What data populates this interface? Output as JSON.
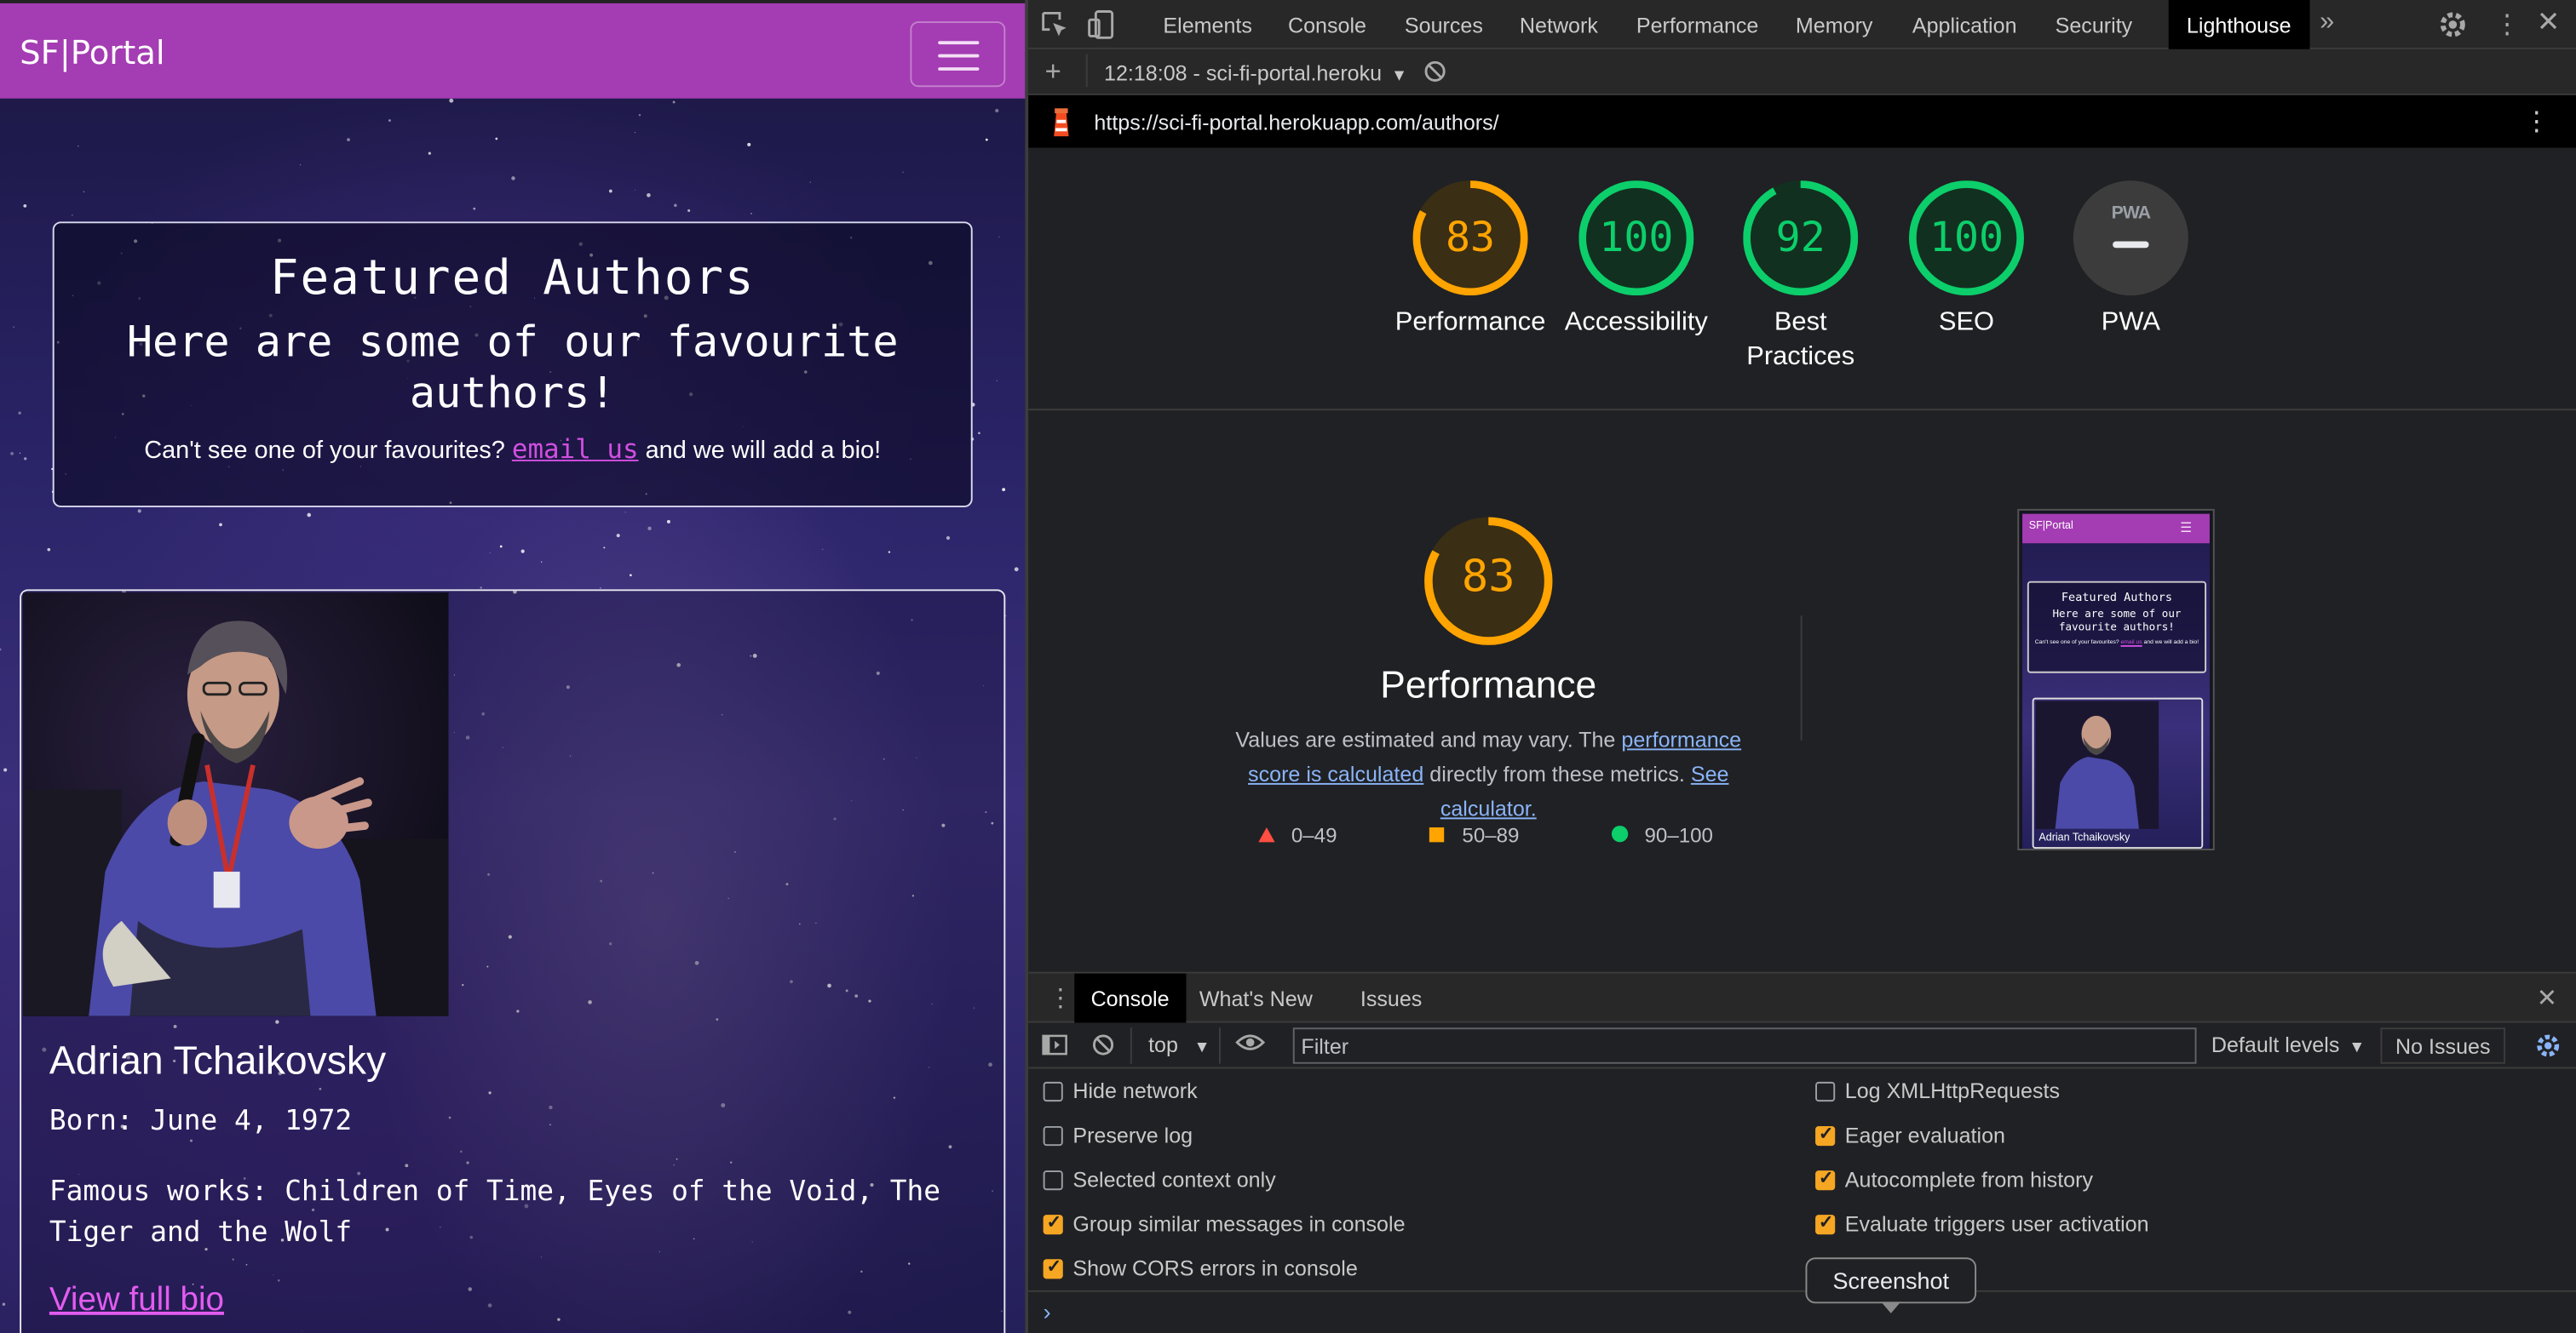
{
  "page": {
    "brand": "SF|Portal",
    "featured": {
      "title": "Featured Authors",
      "subtitle": "Here are some of our favourite authors!",
      "prompt_before": "Can't see one of your favourites?",
      "link": "email us",
      "prompt_after": "and we will add a bio!"
    },
    "author": {
      "name": "Adrian Tchaikovsky",
      "born": "Born: June 4, 1972",
      "works": "Famous works: Children of Time, Eyes of the Void, The Tiger and the Wolf",
      "bio_link": "View full bio"
    }
  },
  "devtools": {
    "tabs": [
      "Elements",
      "Console",
      "Sources",
      "Network",
      "Performance",
      "Memory",
      "Application",
      "Security",
      "Lighthouse"
    ],
    "active_tab": "Lighthouse",
    "report_selector": "12:18:08 - sci-fi-portal.heroku",
    "url": "https://sci-fi-portal.herokuapp.com/authors/",
    "scores": [
      {
        "label": "Performance",
        "value": "83",
        "level": 0.83,
        "color": "#ffa400"
      },
      {
        "label": "Accessibility",
        "value": "100",
        "level": 1.0,
        "color": "#0cce6b"
      },
      {
        "label": "Best Practices",
        "value": "92",
        "level": 0.92,
        "color": "#0cce6b"
      },
      {
        "label": "SEO",
        "value": "100",
        "level": 1.0,
        "color": "#0cce6b"
      },
      {
        "label": "PWA",
        "value": "",
        "level": 0,
        "color": "#9aa0a6"
      }
    ],
    "pwa_badge": "PWA",
    "performance": {
      "score": "83",
      "level": 0.83,
      "label": "Performance",
      "desc_before": "Values are estimated and may vary. The",
      "link1": "performance score is calculated",
      "desc_middle": "directly from these metrics.",
      "link2": "See calculator.",
      "legend": [
        "0–49",
        "50–89",
        "90–100"
      ]
    },
    "thumbnail": {
      "brand": "SF|Portal",
      "title": "Featured Authors",
      "subtitle": "Here are some of our favourite authors!",
      "prompt_before": "Can't see one of your favourites?",
      "link": "email us",
      "prompt_after": "and we will add a bio!",
      "author": "Adrian Tchaikovsky"
    },
    "drawer": {
      "tabs": [
        "Console",
        "What's New",
        "Issues"
      ],
      "active_tab": "Console",
      "context": "top",
      "filter_placeholder": "Filter",
      "levels": "Default levels",
      "issues": "No Issues",
      "options_left": [
        {
          "label": "Hide network",
          "checked": false
        },
        {
          "label": "Preserve log",
          "checked": false
        },
        {
          "label": "Selected context only",
          "checked": false
        },
        {
          "label": "Group similar messages in console",
          "checked": true
        },
        {
          "label": "Show CORS errors in console",
          "checked": true
        }
      ],
      "options_right": [
        {
          "label": "Log XMLHttpRequests",
          "checked": false
        },
        {
          "label": "Eager evaluation",
          "checked": true
        },
        {
          "label": "Autocomplete from history",
          "checked": true
        },
        {
          "label": "Evaluate triggers user activation",
          "checked": true
        }
      ],
      "tooltip": "Screenshot"
    }
  }
}
